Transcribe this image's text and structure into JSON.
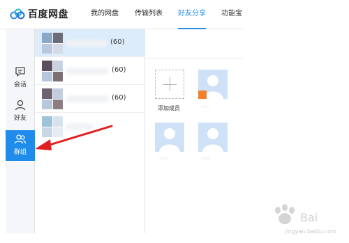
{
  "app": {
    "title": "百度网盘"
  },
  "tabs": [
    {
      "label": "我的网盘",
      "active": false
    },
    {
      "label": "传输列表",
      "active": false
    },
    {
      "label": "好友分享",
      "active": true
    },
    {
      "label": "功能宝",
      "active": false
    }
  ],
  "rail": [
    {
      "label": "会话",
      "icon": "chat-icon",
      "active": false
    },
    {
      "label": "好友",
      "icon": "person-icon",
      "active": false
    },
    {
      "label": "群组",
      "icon": "group-icon",
      "active": true
    }
  ],
  "groups": [
    {
      "count": "(60)",
      "selected": true
    },
    {
      "count": "(60)",
      "selected": false
    },
    {
      "count": "(60)",
      "selected": false
    },
    {
      "count": "",
      "selected": false
    }
  ],
  "panel": {
    "add_member_label": "添加成员"
  },
  "colors": {
    "accent": "#1f8ceb",
    "selected_row": "#dcecfb",
    "annotation": "#e02020"
  },
  "watermark": {
    "text": "jingyan.baidu.com"
  }
}
